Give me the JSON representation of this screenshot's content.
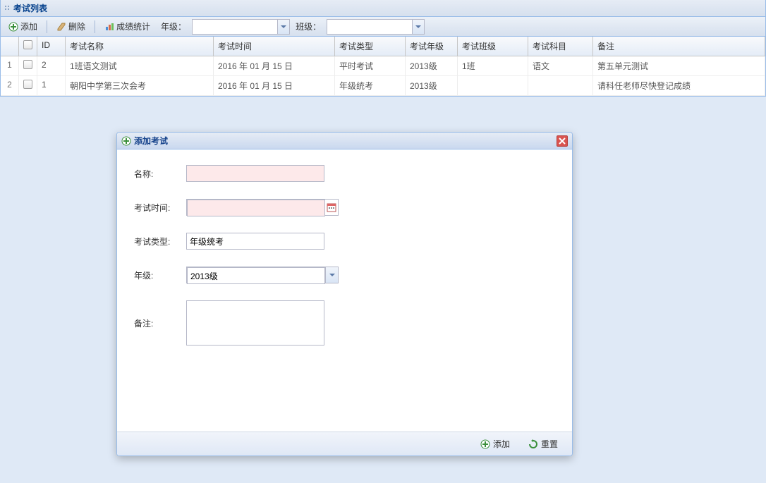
{
  "panel": {
    "title": "考试列表"
  },
  "toolbar": {
    "add": "添加",
    "delete": "删除",
    "stats": "成绩统计",
    "grade_label": "年级：",
    "class_label": "班级："
  },
  "grid": {
    "headers": {
      "id": "ID",
      "name": "考试名称",
      "time": "考试时间",
      "type": "考试类型",
      "grade": "考试年级",
      "class": "考试班级",
      "subject": "考试科目",
      "note": "备注"
    },
    "rows": [
      {
        "rownum": "1",
        "id": "2",
        "name": "1班语文测试",
        "time": "2016 年 01 月 15 日",
        "type": "平时考试",
        "grade": "2013级",
        "class": "1班",
        "subject": "语文",
        "note": "第五单元测试"
      },
      {
        "rownum": "2",
        "id": "1",
        "name": "朝阳中学第三次会考",
        "time": "2016 年 01 月 15 日",
        "type": "年级统考",
        "grade": "2013级",
        "class": "",
        "subject": "",
        "note": "请科任老师尽快登记成绩"
      }
    ]
  },
  "modal": {
    "title": "添加考试",
    "labels": {
      "name": "名称:",
      "time": "考试时间:",
      "type": "考试类型:",
      "grade": "年级:",
      "note": "备注:"
    },
    "values": {
      "name": "",
      "time": "",
      "type": "年级统考",
      "grade": "2013级",
      "note": ""
    },
    "buttons": {
      "add": "添加",
      "reset": "重置"
    }
  }
}
